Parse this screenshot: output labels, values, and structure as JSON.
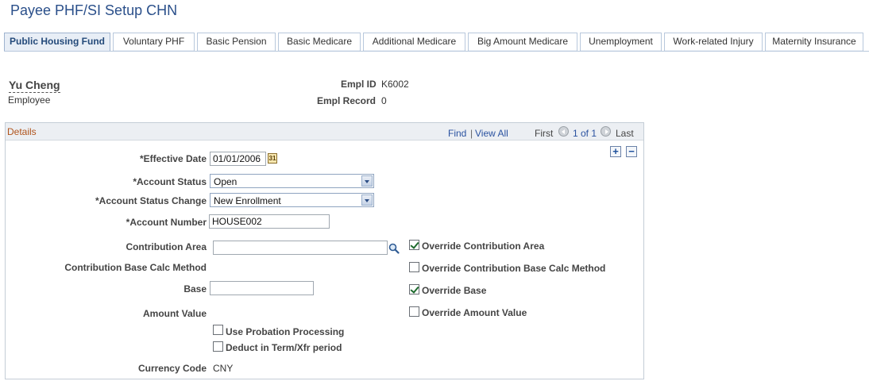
{
  "page": {
    "title": "Payee PHF/SI Setup CHN"
  },
  "tabs": [
    {
      "label": "Public Housing Fund",
      "active": true
    },
    {
      "label": "Voluntary PHF"
    },
    {
      "label": "Basic Pension"
    },
    {
      "label": "Basic Medicare"
    },
    {
      "label": "Additional Medicare"
    },
    {
      "label": "Big Amount Medicare"
    },
    {
      "label": "Unemployment"
    },
    {
      "label": "Work-related Injury"
    },
    {
      "label": "Maternity Insurance"
    }
  ],
  "employee": {
    "name": "Yu Cheng",
    "subtitle": "Employee",
    "empl_id_label": "Empl ID",
    "empl_id": "K6002",
    "empl_record_label": "Empl Record",
    "empl_record": "0"
  },
  "details": {
    "title": "Details",
    "find": "Find",
    "separator": "|",
    "view_all": "View All",
    "first": "First",
    "page_info": "1 of 1",
    "last": "Last",
    "add_button": "+",
    "delete_button": "−"
  },
  "form": {
    "effective_date_label": "*Effective Date",
    "effective_date": "01/01/2006",
    "calendar_glyph": "31",
    "account_status_label": "*Account Status",
    "account_status": "Open",
    "account_status_change_label": "*Account Status Change",
    "account_status_change": "New Enrollment",
    "account_number_label": "*Account Number",
    "account_number": "HOUSE002",
    "contribution_area_label": "Contribution Area",
    "contribution_area": "",
    "contribution_base_calc_label": "Contribution Base Calc Method",
    "base_label": "Base",
    "base": "",
    "amount_value_label": "Amount Value",
    "use_probation_label": "Use Probation Processing",
    "deduct_term_label": "Deduct in Term/Xfr period",
    "currency_code_label": "Currency Code",
    "currency_code": "CNY"
  },
  "overrides": {
    "contribution_area": {
      "label": "Override Contribution Area",
      "checked": true
    },
    "contribution_base_calc": {
      "label": "Override Contribution Base Calc Method",
      "checked": false
    },
    "base": {
      "label": "Override Base",
      "checked": true
    },
    "amount_value": {
      "label": "Override Amount Value",
      "checked": false
    }
  },
  "colors": {
    "title": "#2a4f8a",
    "link": "#2a52a0",
    "panel_title": "#b0541c",
    "check": "#1d6b2d"
  }
}
